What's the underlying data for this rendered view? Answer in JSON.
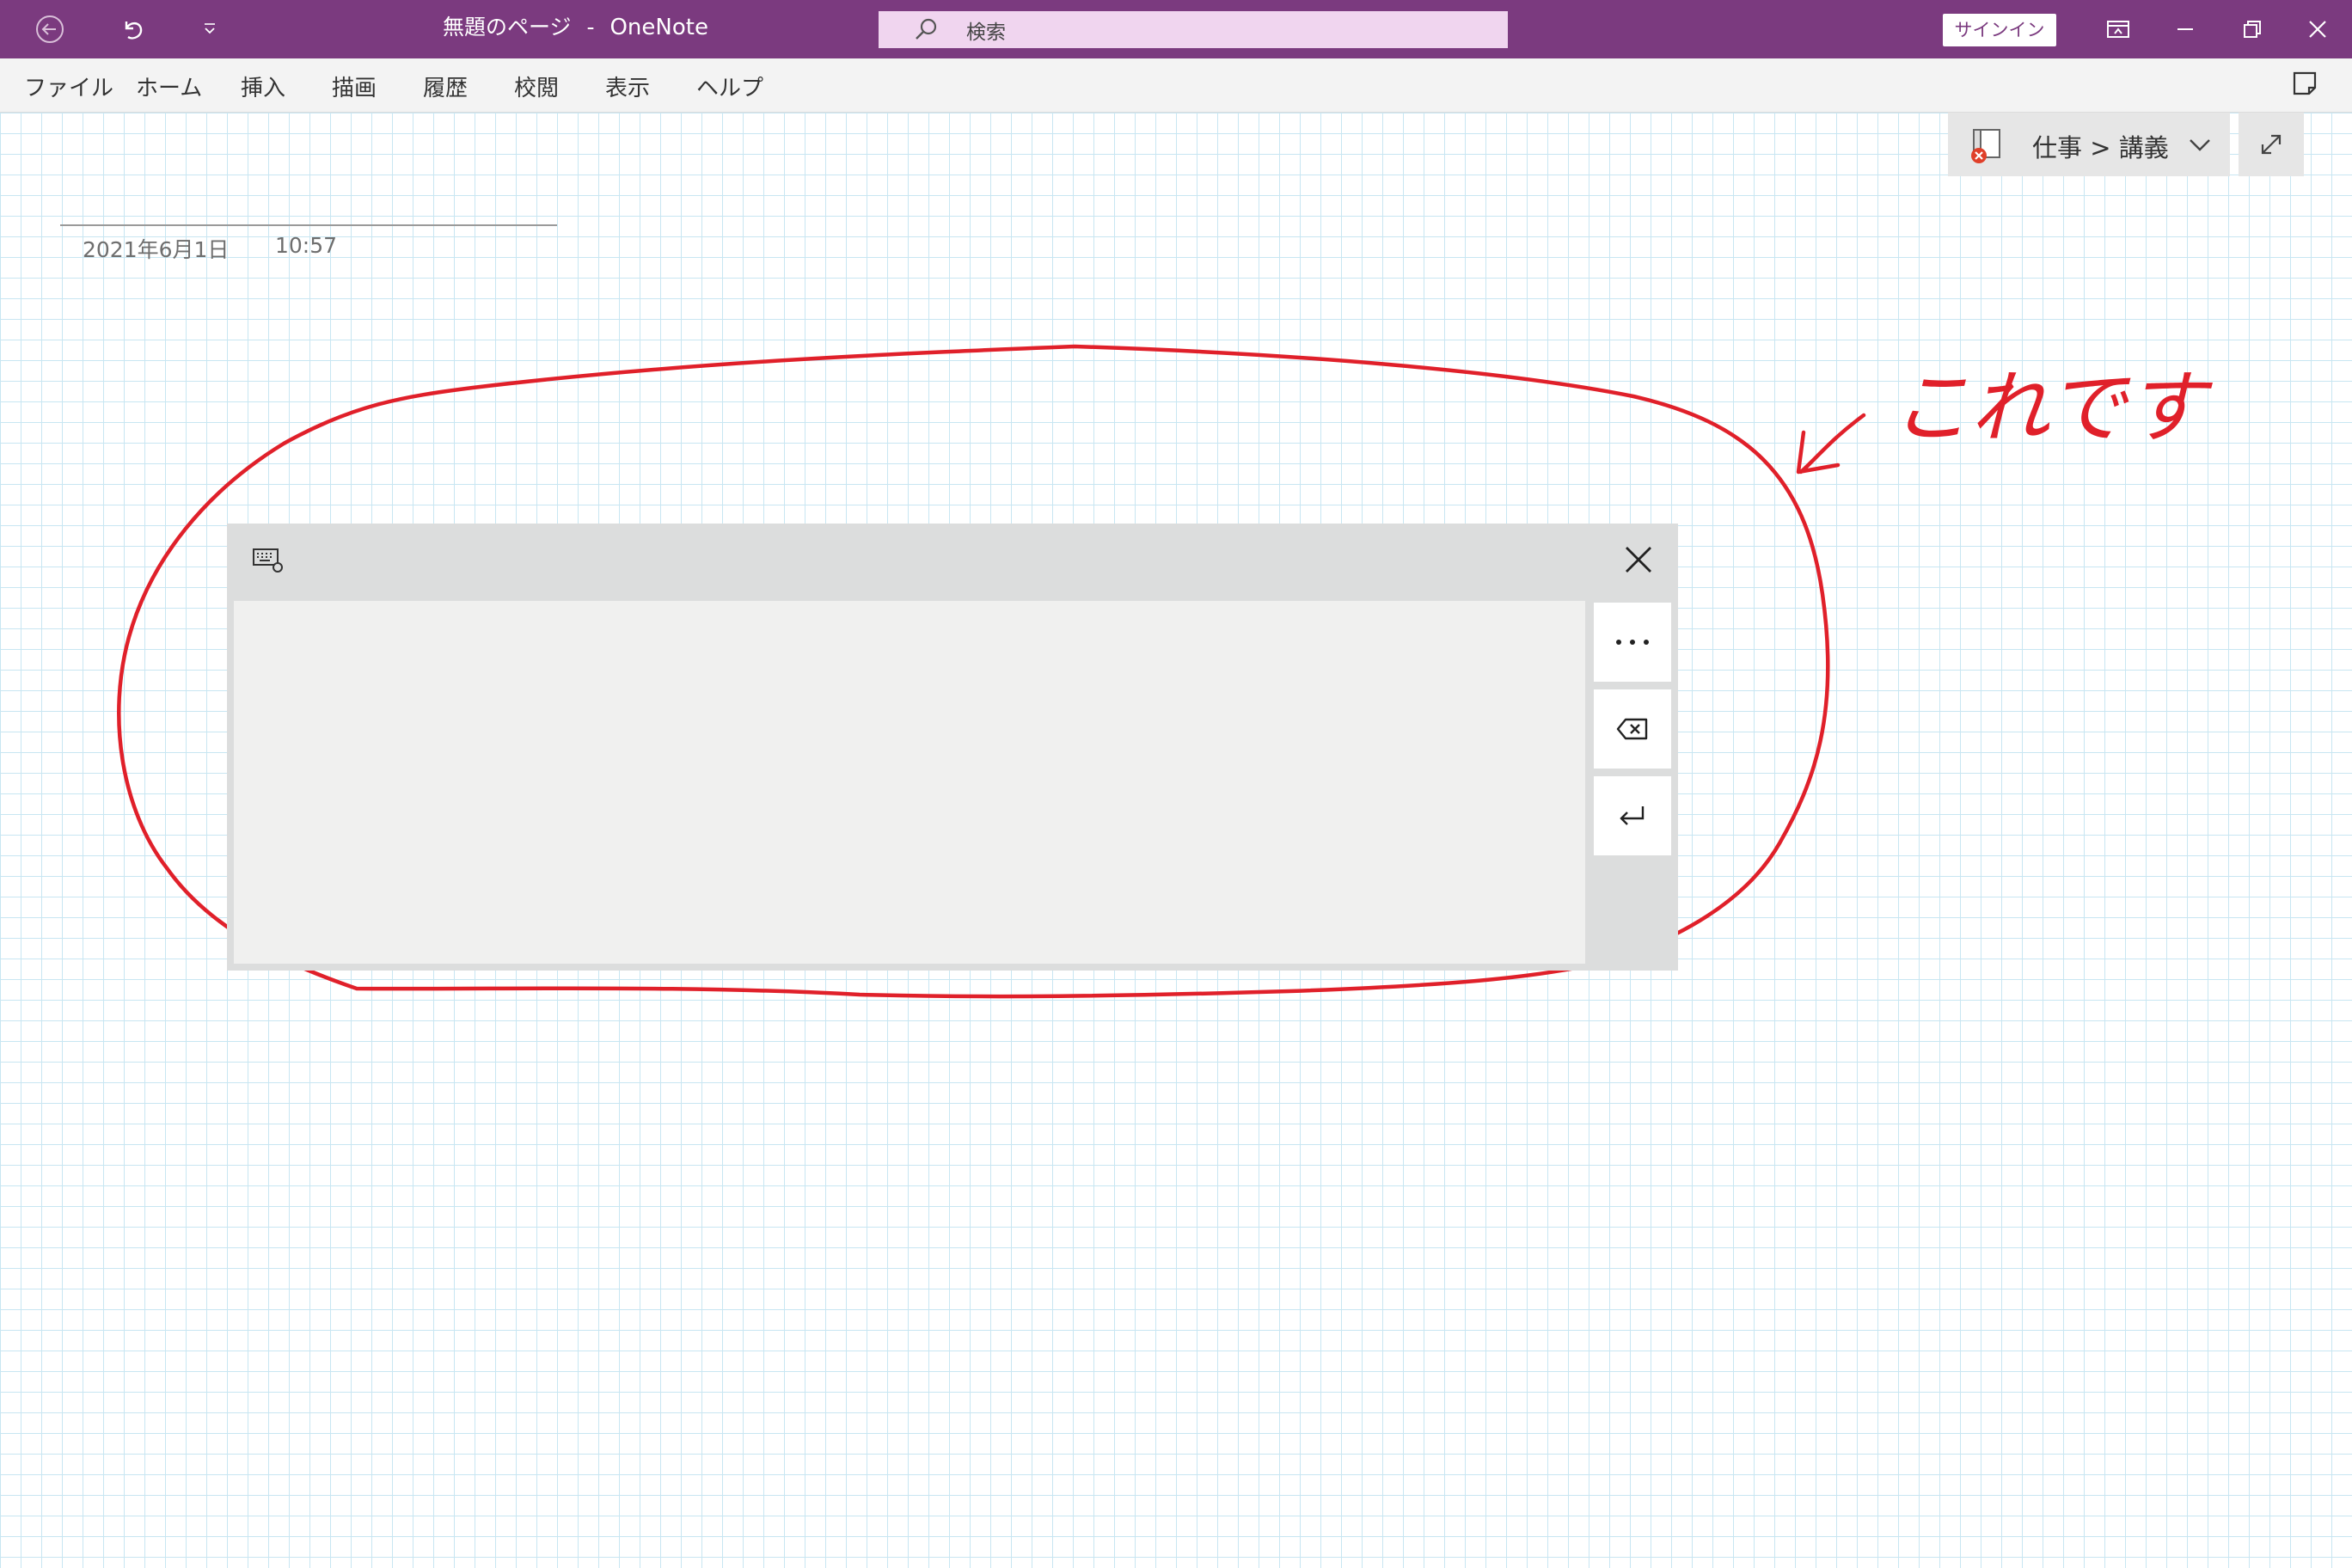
{
  "titlebar": {
    "page_title": "無題のページ",
    "separator": "-",
    "app_name": "OneNote",
    "search_placeholder": "検索",
    "signin_label": "サインイン",
    "accent_color": "#7b3a7f"
  },
  "menu": {
    "items": [
      "ファイル",
      "ホーム",
      "挿入",
      "描画",
      "履歴",
      "校閲",
      "表示",
      "ヘルプ"
    ]
  },
  "breadcrumb": {
    "text": "仕事 > 講義"
  },
  "page": {
    "date": "2021年6月1日",
    "time": "10:57"
  },
  "annotation": {
    "handwriting": "これです",
    "ink_color": "#e0202a"
  },
  "handwriting_panel": {
    "settings_icon": "keyboard-settings-icon",
    "close_icon": "close-icon",
    "more_icon": "more-icon",
    "backspace_icon": "backspace-icon",
    "enter_icon": "enter-icon"
  }
}
